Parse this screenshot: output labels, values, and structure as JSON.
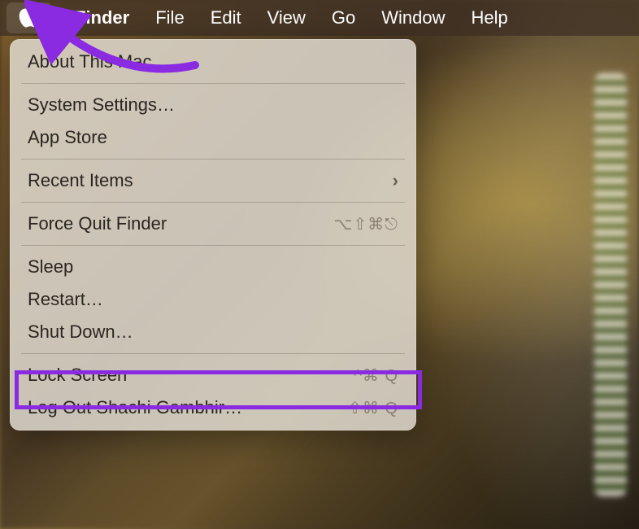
{
  "menubar": {
    "app": "Finder",
    "items": [
      "File",
      "Edit",
      "View",
      "Go",
      "Window",
      "Help"
    ]
  },
  "apple_menu": {
    "about": "About This Mac",
    "settings": "System Settings…",
    "appstore": "App Store",
    "recent": "Recent Items",
    "forcequit": "Force Quit Finder",
    "forcequit_shortcut": "⌥⇧⌘⎋",
    "sleep": "Sleep",
    "restart": "Restart…",
    "shutdown": "Shut Down…",
    "lock": "Lock Screen",
    "lock_shortcut": "^⌘ Q",
    "logout": "Log Out Shachi Gambhir…",
    "logout_shortcut": "⇧⌘ Q"
  },
  "annotation": {
    "arrow_color": "#8a2be2",
    "highlight_color": "#8a2be2"
  }
}
